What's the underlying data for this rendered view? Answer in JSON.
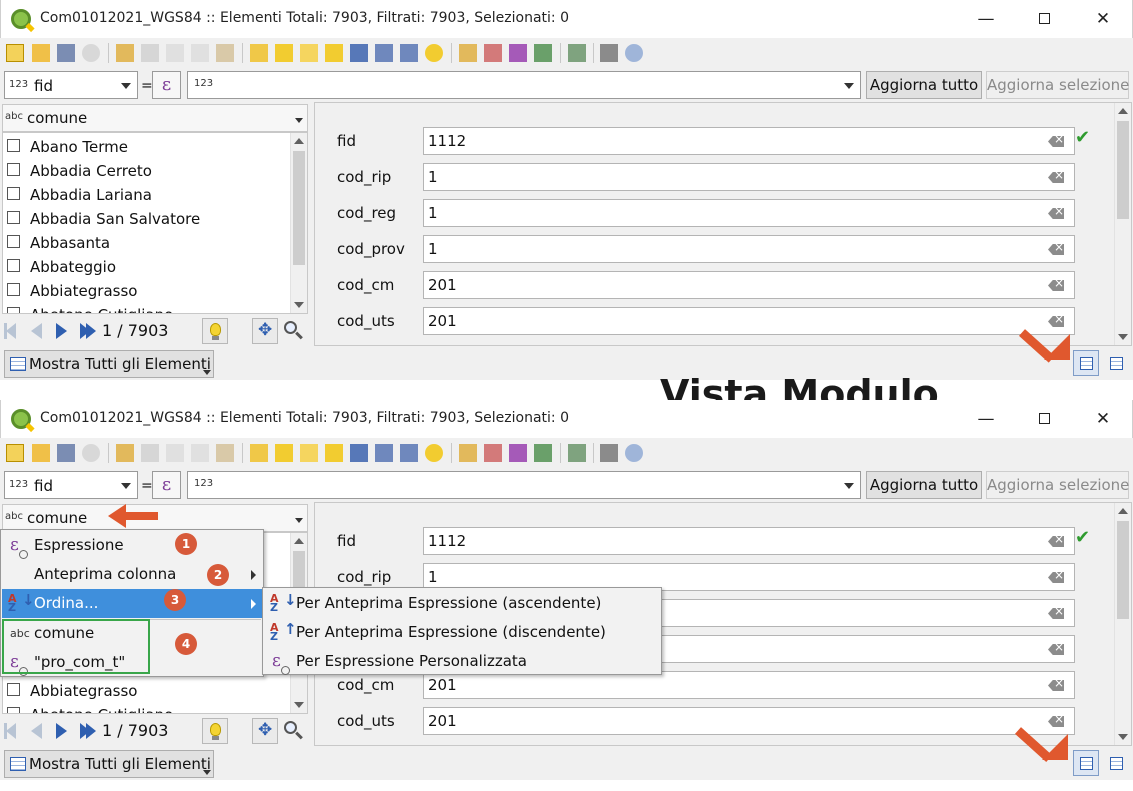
{
  "window": {
    "title": "Com01012021_WGS84 :: Elementi Totali: 7903, Filtrati: 7903, Selezionati: 0",
    "minimize_label": "—",
    "maximize_label": "",
    "close_label": "✕"
  },
  "filter": {
    "field_type": "123",
    "field_name": "fid",
    "equals": "=",
    "expression_symbol": "ε",
    "value_type": "123",
    "value": "",
    "update_all": "Aggiorna tutto",
    "update_selection": "Aggiorna selezione"
  },
  "list": {
    "column_type": "abc",
    "column_name": "comune",
    "items": [
      "Abano Terme",
      "Abbadia Cerreto",
      "Abbadia Lariana",
      "Abbadia San Salvatore",
      "Abbasanta",
      "Abbateggio",
      "Abbiategrasso",
      "Abetone Cutigliano"
    ]
  },
  "navigation": {
    "counter": "1 / 7903"
  },
  "form": {
    "fields": [
      {
        "label": "fid",
        "value": "1112"
      },
      {
        "label": "cod_rip",
        "value": "1"
      },
      {
        "label": "cod_reg",
        "value": "1"
      },
      {
        "label": "cod_prov",
        "value": "1"
      },
      {
        "label": "cod_cm",
        "value": "201"
      },
      {
        "label": "cod_uts",
        "value": "201"
      }
    ],
    "valid_mark": "✔"
  },
  "footer": {
    "show_all": "Mostra Tutti gli Elementi"
  },
  "annotation": {
    "heading": "Vista Modulo"
  },
  "context_menu": {
    "items": [
      {
        "label": "Espressione",
        "badge": "1"
      },
      {
        "label": "Anteprima colonna",
        "badge": "2"
      },
      {
        "label": "Ordina...",
        "badge": "3"
      }
    ],
    "columns": [
      {
        "type": "abc",
        "label": "comune"
      },
      {
        "label": "\"pro_com_t\""
      }
    ],
    "columns_badge": "4"
  },
  "sort_submenu": {
    "items": [
      "Per Anteprima Espressione (ascendente)",
      "Per Anteprima Espressione (discendente)",
      "Per Espressione Personalizzata"
    ]
  },
  "colors": {
    "accent_highlight": "#3f8fdc",
    "annotation_arrow": "#e0582e",
    "badge": "#d75a3a",
    "group_box": "#39a64a",
    "valid": "#2e9b2e"
  }
}
